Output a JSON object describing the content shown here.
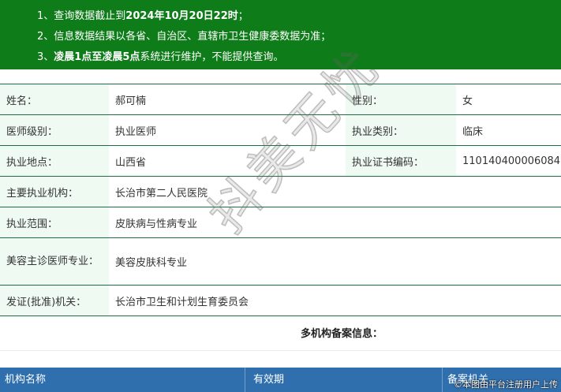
{
  "notice": {
    "line1_prefix": "1、查询数据截止到",
    "line1_bold": "2024年10月20日22时",
    "line1_suffix": "；",
    "line2": "2、信息数据结果以各省、自治区、直辖市卫生健康委数据为准；",
    "line3_prefix": "3、",
    "line3_bold": "凌晨1点至凌晨5点",
    "line3_suffix": "系统进行维护，不能提供查询。"
  },
  "info": {
    "name_label": "姓名：",
    "name_value": "郝可楠",
    "gender_label": "性别：",
    "gender_value": "女",
    "level_label": "医师级别：",
    "level_value": "执业医师",
    "category_label": "执业类别：",
    "category_value": "临床",
    "location_label": "执业地点：",
    "location_value": "山西省",
    "cert_label": "执业证书编码：",
    "cert_value": "110140400006084",
    "org_label": "主要执业机构：",
    "org_value": "长治市第二人民医院",
    "scope_label": "执业范围：",
    "scope_value": "皮肤病与性病专业",
    "cosmetic_label": "美容主诊医师专业：",
    "cosmetic_value": "美容皮肤科专业",
    "issuer_label": "发证(批准)机关：",
    "issuer_value": "长治市卫生和计划生育委员会"
  },
  "multi": {
    "title": "多机构备案信息：",
    "col1": "机构名称",
    "col2": "有效期",
    "col3": "备案机关"
  },
  "watermark": "抖美无忧",
  "credit": "©本图由平台注册用户上传",
  "colors": {
    "notice_bg": "#0f7c1a",
    "label_bg": "#eefaf2",
    "border": "#1e6e45",
    "table_header_bg": "#2f6fae"
  }
}
